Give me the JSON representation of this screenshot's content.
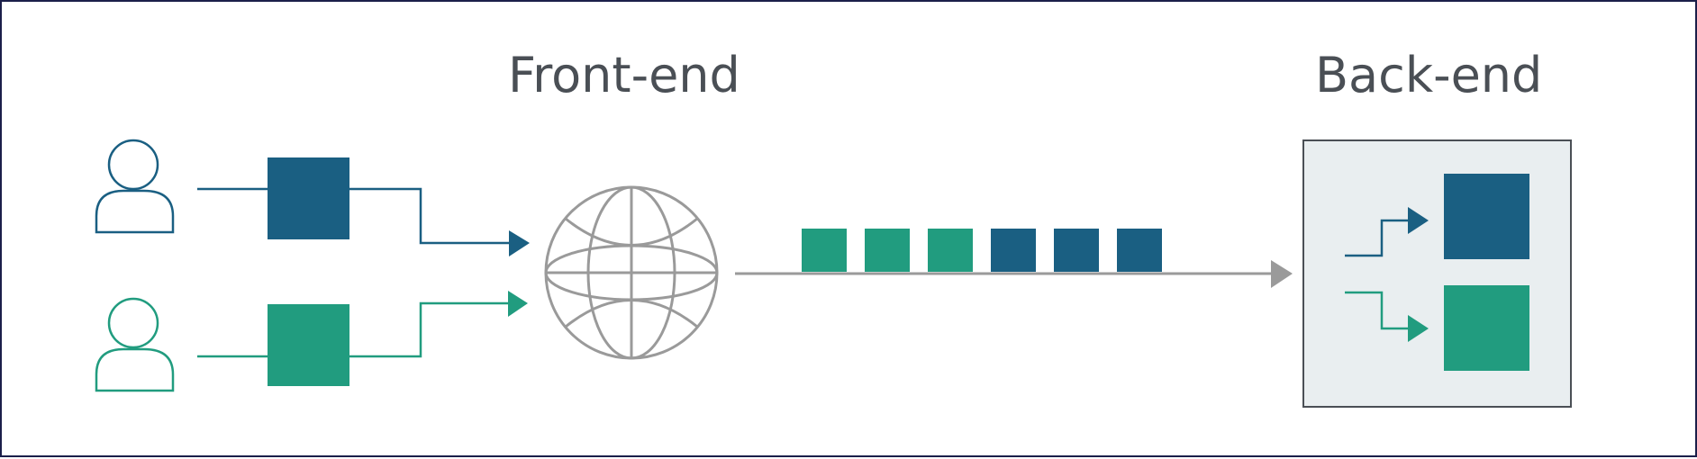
{
  "headings": {
    "front_end": "Front-end",
    "back_end": "Back-end"
  },
  "colors": {
    "blue": "#1a5f82",
    "green": "#219c7f",
    "gray": "#9a9a9a",
    "backend_fill": "#e9eef0",
    "backend_border": "#4a4f55",
    "heading": "#4a4f55",
    "frame_border": "#1b1f4a"
  },
  "icons": {
    "user_top": "user-icon",
    "user_bottom": "user-icon",
    "network": "globe-icon"
  },
  "queue": [
    "green",
    "green",
    "green",
    "blue",
    "blue",
    "blue"
  ]
}
